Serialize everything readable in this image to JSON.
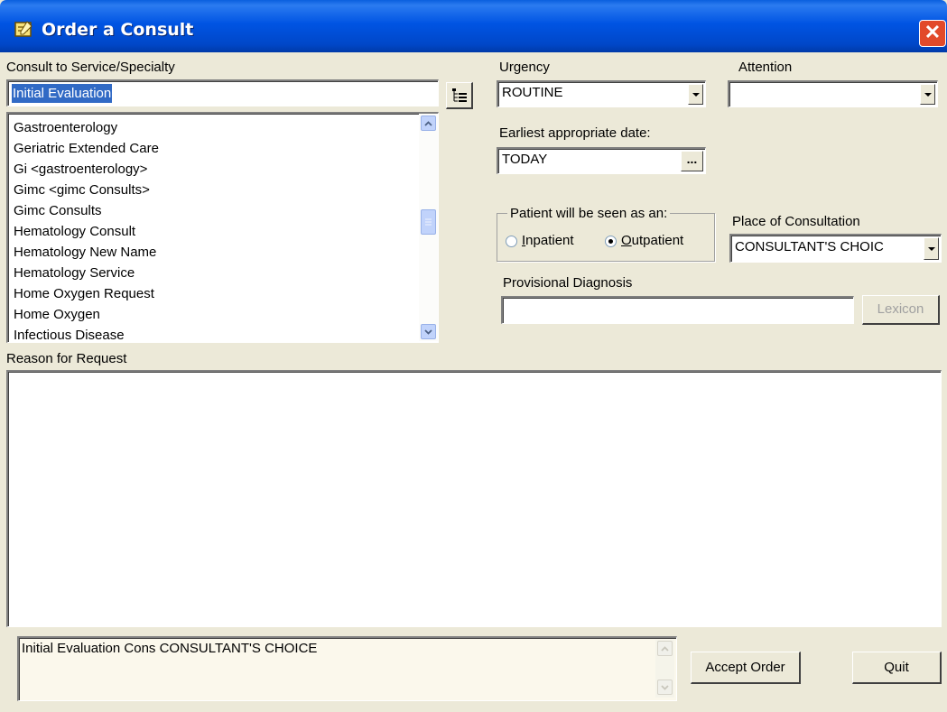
{
  "window": {
    "title": "Order a Consult",
    "icon": "notepad-icon",
    "close_glyph": "✕"
  },
  "consult": {
    "label": "Consult to Service/Specialty",
    "value": "Initial Evaluation",
    "tree_button_icon": "tree-view-icon",
    "items": [
      "Gastroenterology",
      "Geriatric Extended Care",
      "Gi  <gastroenterology>",
      "Gimc  <gimc Consults>",
      "Gimc Consults",
      "Hematology Consult",
      "Hematology New Name",
      "Hematology Service",
      "Home Oxygen Request",
      "Home Oxygen",
      "Infectious Disease"
    ]
  },
  "urgency": {
    "label": "Urgency",
    "value": "ROUTINE"
  },
  "attention": {
    "label": "Attention",
    "value": ""
  },
  "earliest_date": {
    "label": "Earliest appropriate date:",
    "value": "TODAY",
    "button": "..."
  },
  "patient": {
    "group_label": "Patient will be seen as an:",
    "inpatient_first": "I",
    "inpatient_rest": "npatient",
    "outpatient_first": "O",
    "outpatient_rest": "utpatient",
    "selected": "outpatient"
  },
  "place": {
    "label": "Place of Consultation",
    "value": "CONSULTANT'S CHOIC"
  },
  "diagnosis": {
    "label": "Provisional Diagnosis",
    "value": "",
    "lexicon_button": "Lexicon"
  },
  "reason": {
    "label": "Reason for Request",
    "value": ""
  },
  "summary": {
    "text": "Initial Evaluation Cons CONSULTANT'S CHOICE"
  },
  "buttons": {
    "accept": "Accept Order",
    "quit": "Quit"
  },
  "colors": {
    "title_bar": "#0054e3",
    "selection": "#316ac5",
    "face": "#ece9d8",
    "summary_bg": "#fbf8ec"
  }
}
